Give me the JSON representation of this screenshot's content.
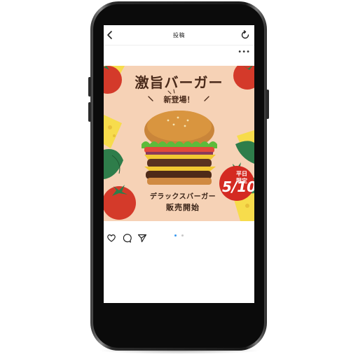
{
  "screen": {
    "title": "投稿"
  },
  "post": {
    "headline": "激旨バーガー",
    "subheadline": "新登場！",
    "product_name": "デラックスバーガー",
    "sale_text": "販売開始",
    "badge": {
      "line1": "平日",
      "line2": "限定",
      "date": "5/10"
    },
    "carousel": {
      "count": 2,
      "active_index": 0
    }
  },
  "colors": {
    "post_background": "#f6d2b6",
    "badge": "#d42a22",
    "dot_active": "#3897f0",
    "dot_inactive": "#c7c7c7"
  },
  "icons": {
    "back": "chevron-left-icon",
    "refresh": "refresh-icon",
    "more": "more-dots-icon",
    "like": "heart-icon",
    "comment": "comment-icon",
    "share": "send-icon"
  }
}
